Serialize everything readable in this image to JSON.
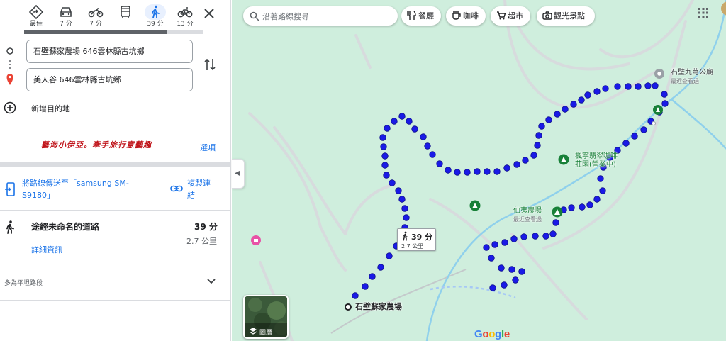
{
  "travel_modes": [
    {
      "id": "best",
      "label": "最佳",
      "icon": "diamond-turn-icon"
    },
    {
      "id": "car",
      "label": "7 分",
      "icon": "car-icon"
    },
    {
      "id": "motorcycle",
      "label": "7 分",
      "icon": "motorcycle-icon"
    },
    {
      "id": "transit",
      "label": "",
      "icon": "bus-icon"
    },
    {
      "id": "walk",
      "label": "39 分",
      "icon": "walk-icon",
      "active": true
    },
    {
      "id": "bike",
      "label": "13 分",
      "icon": "bicycle-icon"
    }
  ],
  "route": {
    "origin": "石壁蘇家農場 646雲林縣古坑鄉",
    "destination": "美人谷 646雲林縣古坑鄉",
    "add_destination": "新增目的地"
  },
  "blog_logo": "藝海小伊亞。牽手旅行意藝趣",
  "options_label": "選項",
  "send_to_device": "將路線傳送至「samsung SM-S9180」",
  "copy_link": "複製連結",
  "route_summary": {
    "name": "途經未命名的道路",
    "time": "39 分",
    "distance": "2.7 公里",
    "details": "詳細資訊"
  },
  "flat_note": "多為平坦路段",
  "map": {
    "search_placeholder": "沿著路線搜尋",
    "chips": [
      {
        "label": "餐廳",
        "icon": "fork-knife-icon"
      },
      {
        "label": "咖啡",
        "icon": "coffee-icon"
      },
      {
        "label": "超市",
        "icon": "cart-icon"
      },
      {
        "label": "觀光景點",
        "icon": "camera-icon"
      }
    ],
    "places": {
      "jiuqiong_name": "石壁九芎公廟",
      "jiuqiong_sub": "最近查看過",
      "fengyu_name": "楓寧翡翠咖啡",
      "fengyu_name2": "莊園(營業中)",
      "xianyi_name": "仙夷農場",
      "xianyi_sub": "最近查看過",
      "origin_label": "石壁蘇家農場"
    },
    "time_bubble": {
      "time": "39 分",
      "distance": "2.7 公里"
    },
    "layers_label": "圖層",
    "google": "Google"
  },
  "colors": {
    "map_bg": "#cfeedd",
    "river": "#8fd0ec",
    "route_dot": "#1a1ae6",
    "accent": "#1a73e8"
  }
}
